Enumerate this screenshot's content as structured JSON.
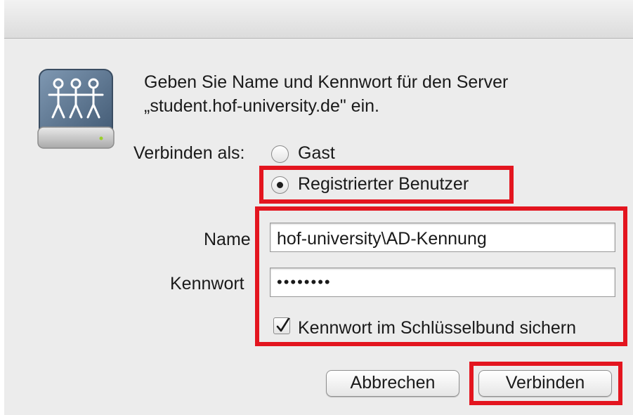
{
  "dialog": {
    "message_line1": "Geben Sie Name und Kennwort für den Server",
    "message_line2": "„student.hof-university.de\" ein."
  },
  "connect_as": {
    "label": "Verbinden als:",
    "options": [
      {
        "label": "Gast",
        "selected": false
      },
      {
        "label": "Registrierter Benutzer",
        "selected": true
      }
    ]
  },
  "form": {
    "name_label": "Name",
    "name_value": "hof-university\\AD-Kennung",
    "password_label": "Kennwort",
    "password_value": "••••••••",
    "remember_label": "Kennwort im Schlüsselbund sichern",
    "remember_checked": true
  },
  "buttons": {
    "cancel": "Abbrechen",
    "connect": "Verbinden"
  },
  "colors": {
    "highlight": "#e3151f",
    "dialog_background": "#ececec"
  },
  "icons": {
    "server": "network-drive-icon",
    "checkmark": "checkmark-icon"
  }
}
